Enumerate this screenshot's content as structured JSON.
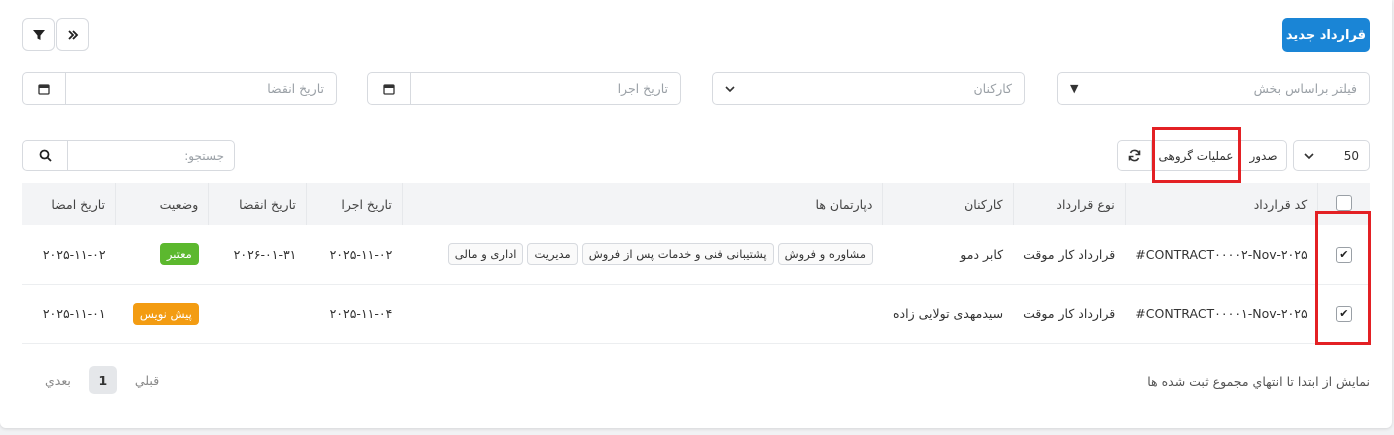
{
  "header": {
    "new_contract_label": "قرارداد جدید"
  },
  "filters": {
    "department_placeholder": "فیلتر براساس بخش",
    "staff_placeholder": "کارکنان",
    "exec_date_placeholder": "تاریخ اجرا",
    "expiry_date_placeholder": "تاریخ انقضا"
  },
  "toolbar": {
    "page_size": "50",
    "export_label": "صدور",
    "bulk_actions_label": "عملیات گروهی",
    "search_placeholder": "جستجو:"
  },
  "table": {
    "columns": [
      "کد قرارداد",
      "نوع قرارداد",
      "کارکنان",
      "دپارتمان ها",
      "تاریخ اجرا",
      "تاریخ انقضا",
      "وضعیت",
      "تاریخ امضا"
    ],
    "rows": [
      {
        "code": "#CONTRACT۰۰۰۰۲-Nov-۲۰۲۵",
        "type": "قرارداد کار موقت",
        "staff": "کابر دمو",
        "departments": [
          "مشاوره و فروش",
          "پشتیبانی فنی و خدمات پس از فروش",
          "مدیریت",
          "اداری و مالی"
        ],
        "exec_date": "۲۰۲۵-۱۱-۰۲",
        "expiry_date": "۲۰۲۶-۰۱-۳۱",
        "status": "معتبر",
        "status_color": "#5cb82e",
        "sign_date": "۲۰۲۵-۱۱-۰۲"
      },
      {
        "code": "#CONTRACT۰۰۰۰۱-Nov-۲۰۲۵",
        "type": "قرارداد کار موقت",
        "staff": "سیدمهدی تولایی زاده",
        "departments": [],
        "exec_date": "۲۰۲۵-۱۱-۰۴",
        "expiry_date": "",
        "status": "پیش نویس",
        "status_color": "#f39c12",
        "sign_date": "۲۰۲۵-۱۱-۰۱"
      }
    ]
  },
  "footer": {
    "info": "نمایش از ابتدا تا انتهاي مجموع ثبت شده ها",
    "prev_label": "قبلي",
    "page": "1",
    "next_label": "بعدي"
  },
  "colors": {
    "primary": "#1a85d6",
    "highlight": "#e32024"
  }
}
